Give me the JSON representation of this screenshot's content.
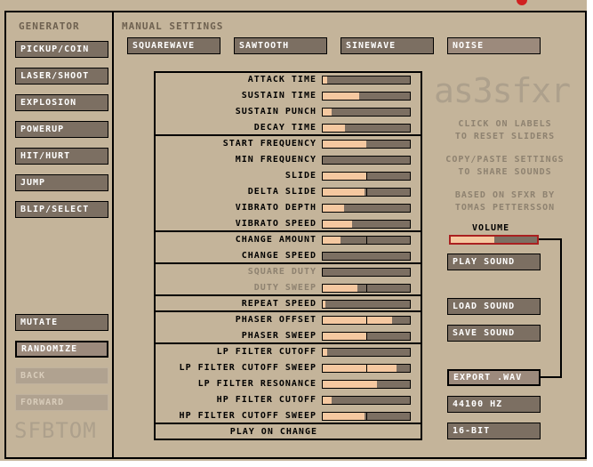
{
  "colors": {
    "background": "#c4b49a",
    "button": "#7c6f62",
    "slider_fill": "#f5c8a0",
    "volume_border": "#aa2020"
  },
  "generator": {
    "title": "GENERATOR",
    "buttons": [
      "PICKUP/COIN",
      "LASER/SHOOT",
      "EXPLOSION",
      "POWERUP",
      "HIT/HURT",
      "JUMP",
      "BLIP/SELECT"
    ],
    "mutate": "MUTATE",
    "randomize": "RANDOMIZE",
    "back": "BACK",
    "forward": "FORWARD",
    "author": "SFBTOM"
  },
  "manual": {
    "title": "MANUAL SETTINGS",
    "waves": [
      "SQUAREWAVE",
      "SAWTOOTH",
      "SINEWAVE",
      "NOISE"
    ],
    "selected_wave": "NOISE"
  },
  "sliders": [
    {
      "label": "ATTACK TIME",
      "value": 0.05,
      "bipolar": false
    },
    {
      "label": "SUSTAIN TIME",
      "value": 0.42,
      "bipolar": false
    },
    {
      "label": "SUSTAIN PUNCH",
      "value": 0.1,
      "bipolar": false
    },
    {
      "label": "DECAY TIME",
      "value": 0.25,
      "bipolar": false
    },
    {
      "label": "START FREQUENCY",
      "value": 0.5,
      "bipolar": false
    },
    {
      "label": "MIN FREQUENCY",
      "value": 0.0,
      "bipolar": false
    },
    {
      "label": "SLIDE",
      "value": 0.5,
      "bipolar": true
    },
    {
      "label": "DELTA SLIDE",
      "value": 0.48,
      "bipolar": true
    },
    {
      "label": "VIBRATO DEPTH",
      "value": 0.24,
      "bipolar": false
    },
    {
      "label": "VIBRATO SPEED",
      "value": 0.34,
      "bipolar": false
    },
    {
      "label": "CHANGE AMOUNT",
      "value": 0.2,
      "bipolar": true
    },
    {
      "label": "CHANGE SPEED",
      "value": 0.0,
      "bipolar": false
    },
    {
      "label": "SQUARE DUTY",
      "value": 0.0,
      "bipolar": false,
      "disabled": true
    },
    {
      "label": "DUTY SWEEP",
      "value": 0.4,
      "bipolar": true,
      "disabled": true
    },
    {
      "label": "REPEAT SPEED",
      "value": 0.03,
      "bipolar": false
    },
    {
      "label": "PHASER OFFSET",
      "value": 0.8,
      "bipolar": true
    },
    {
      "label": "PHASER SWEEP",
      "value": 0.5,
      "bipolar": true
    },
    {
      "label": "LP FILTER CUTOFF",
      "value": 0.05,
      "bipolar": false
    },
    {
      "label": "LP FILTER CUTOFF SWEEP",
      "value": 0.85,
      "bipolar": true
    },
    {
      "label": "LP FILTER RESONANCE",
      "value": 0.62,
      "bipolar": false
    },
    {
      "label": "HP FILTER CUTOFF",
      "value": 0.1,
      "bipolar": false
    },
    {
      "label": "HP FILTER CUTOFF SWEEP",
      "value": 0.48,
      "bipolar": true
    }
  ],
  "play_on_change": "PLAY ON CHANGE",
  "logo": "as3sfxr",
  "info": {
    "line1": "CLICK ON LABELS",
    "line2": "TO RESET SLIDERS",
    "line3": "COPY/PASTE SETTINGS",
    "line4": "TO SHARE SOUNDS",
    "line5": "BASED ON SFXR BY",
    "line6": "TOMAS PETTERSSON"
  },
  "volume": {
    "label": "VOLUME",
    "value": 0.5
  },
  "actions": {
    "play": "PLAY SOUND",
    "load": "LOAD SOUND",
    "save": "SAVE SOUND",
    "export": "EXPORT .WAV",
    "rate": "44100 HZ",
    "bits": "16-BIT"
  }
}
